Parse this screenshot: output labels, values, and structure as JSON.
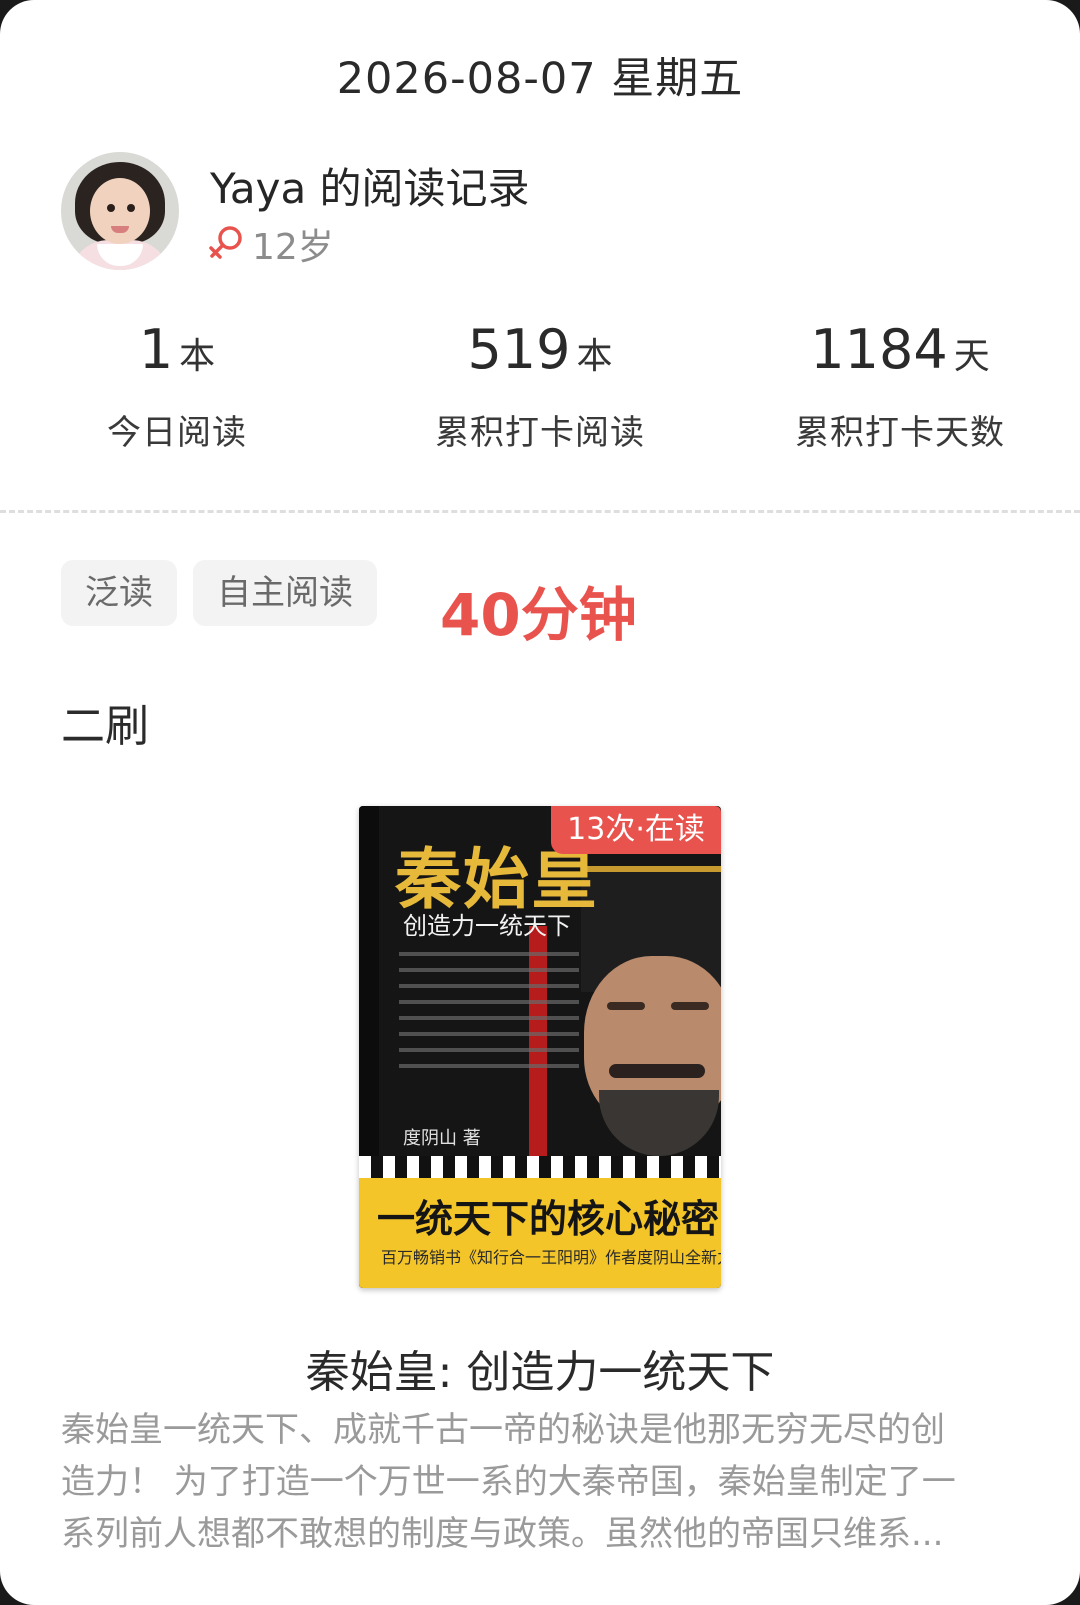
{
  "date": "2026-08-07 星期五",
  "profile": {
    "title": "Yaya 的阅读记录",
    "age": "12岁"
  },
  "stats": [
    {
      "value": "1",
      "unit": "本",
      "label": "今日阅读"
    },
    {
      "value": "519",
      "unit": "本",
      "label": "累积打卡阅读"
    },
    {
      "value": "1184",
      "unit": "天",
      "label": "累积打卡天数"
    }
  ],
  "tags": [
    "泛读",
    "自主阅读"
  ],
  "duration": "40分钟",
  "note": "二刷",
  "book": {
    "badge": "13次·在读",
    "cover_title": "秦始皇",
    "cover_subtitle": "创造力一统天下",
    "cover_author": "度阴山 著",
    "cover_band": "一统天下的核心秘密",
    "cover_band_small": "百万畅销书《知行合一王阳明》作者度阴山全新力作",
    "title": "秦始皇: 创造力一统天下",
    "description_lines": [
      "秦始皇一统天下、成就千古一帝的秘诀是他那无穷无尽的创",
      "造力！ 为了打造一个万世一系的大秦帝国，秦始皇制定了一",
      "系列前人想都不敢想的制度与政策。虽然他的帝国只维系..."
    ]
  },
  "colors": {
    "accent": "#e9534e",
    "gender": "#e9534e",
    "tag_bg": "#f3f3f3",
    "muted_text": "#9a9a9a"
  },
  "icons": {
    "gender": "female-icon"
  }
}
